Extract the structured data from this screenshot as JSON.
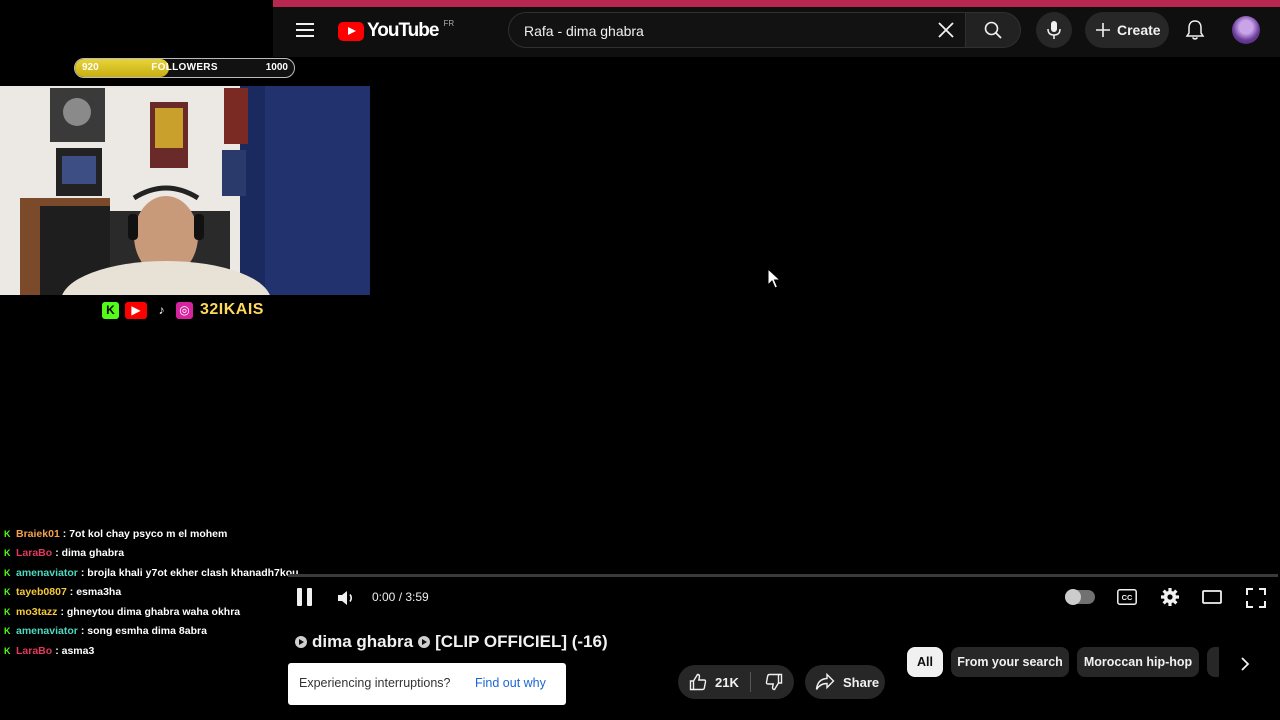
{
  "header": {
    "logo_text": "YouTube",
    "country_code": "FR",
    "search_value": "Rafa - dima ghabra",
    "create_label": "Create"
  },
  "overlay": {
    "followers": {
      "current": 920,
      "target": 1000,
      "min_label": "920",
      "label": "FOLLOWERS",
      "max_label": "1000",
      "progress_fraction": 0.43
    },
    "social_handle": "32IKAIS"
  },
  "chat": [
    {
      "user": "Braiek01",
      "color": "#f5a24b",
      "message": ": 7ot kol chay psyco m el mohem"
    },
    {
      "user": "LaraBo",
      "color": "#e23a5e",
      "message": ": dima ghabra"
    },
    {
      "user": "amenaviator",
      "color": "#4ed9c0",
      "message": ": brojla khali y7ot ekher clash khanadh7kou"
    },
    {
      "user": "tayeb0807",
      "color": "#f5c93b",
      "message": ": esma3ha"
    },
    {
      "user": "mo3tazz",
      "color": "#f5c93b",
      "message": ": ghneytou dima ghabra waha okhra"
    },
    {
      "user": "amenaviator",
      "color": "#4ed9c0",
      "message": ": song esmha dima 8abra"
    },
    {
      "user": "LaraBo",
      "color": "#e23a5e",
      "message": ": asma3"
    }
  ],
  "player": {
    "time": "0:00 / 3:59",
    "progress_fraction": 0.0
  },
  "video": {
    "title_part1": "dima ghabra",
    "title_part2": "[CLIP OFFICIEL] (-16)",
    "likes": "21K",
    "share_label": "Share"
  },
  "notice": {
    "text": "Experiencing interruptions?",
    "link": "Find out why"
  },
  "chips": [
    "All",
    "From your search",
    "Moroccan hip-hop"
  ],
  "colors": {
    "brand_red": "#ff0000",
    "accent_line": "#b8274f",
    "kick_green": "#53fc18"
  }
}
